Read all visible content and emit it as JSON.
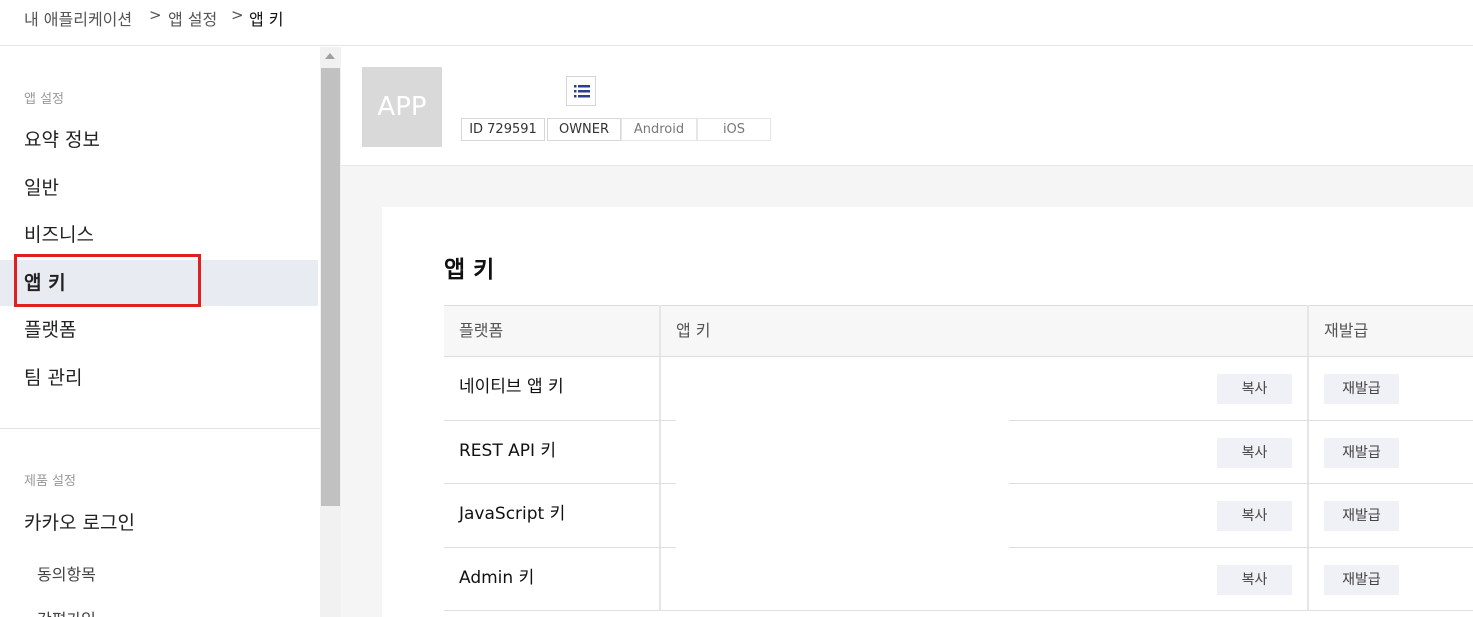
{
  "breadcrumb": {
    "items": [
      "내 애플리케이션",
      "앱 설정",
      "앱 키"
    ],
    "separator": ">"
  },
  "sidebar": {
    "app_section_label": "앱 설정",
    "app_items": [
      "요약 정보",
      "일반",
      "비즈니스",
      "앱 키",
      "플랫폼",
      "팀 관리"
    ],
    "active_item": "앱 키",
    "product_section_label": "제품 설정",
    "product_items": [
      "카카오 로그인"
    ],
    "sub_items": [
      "동의항목",
      "간편가입"
    ]
  },
  "app_header": {
    "logo_text": "APP",
    "list_icon": "list-icon",
    "tags": [
      "ID 729591",
      "OWNER",
      "Android",
      "iOS"
    ]
  },
  "content": {
    "title": "앱 키",
    "table": {
      "headers": [
        "플랫폼",
        "앱 키",
        "재발급"
      ],
      "rows": [
        {
          "platform": "네이티브 앱 키",
          "key": "",
          "copy_label": "복사",
          "reissue_label": "재발급"
        },
        {
          "platform": "REST API 키",
          "key": "",
          "copy_label": "복사",
          "reissue_label": "재발급"
        },
        {
          "platform": "JavaScript 키",
          "key": "",
          "copy_label": "복사",
          "reissue_label": "재발급"
        },
        {
          "platform": "Admin 키",
          "key": "",
          "copy_label": "복사",
          "reissue_label": "재발급"
        }
      ]
    }
  },
  "colors": {
    "highlight": "#e02020",
    "active_bg": "#e9ebf2",
    "button_bg": "#f0f1f6",
    "page_bg": "#f5f5f5"
  }
}
